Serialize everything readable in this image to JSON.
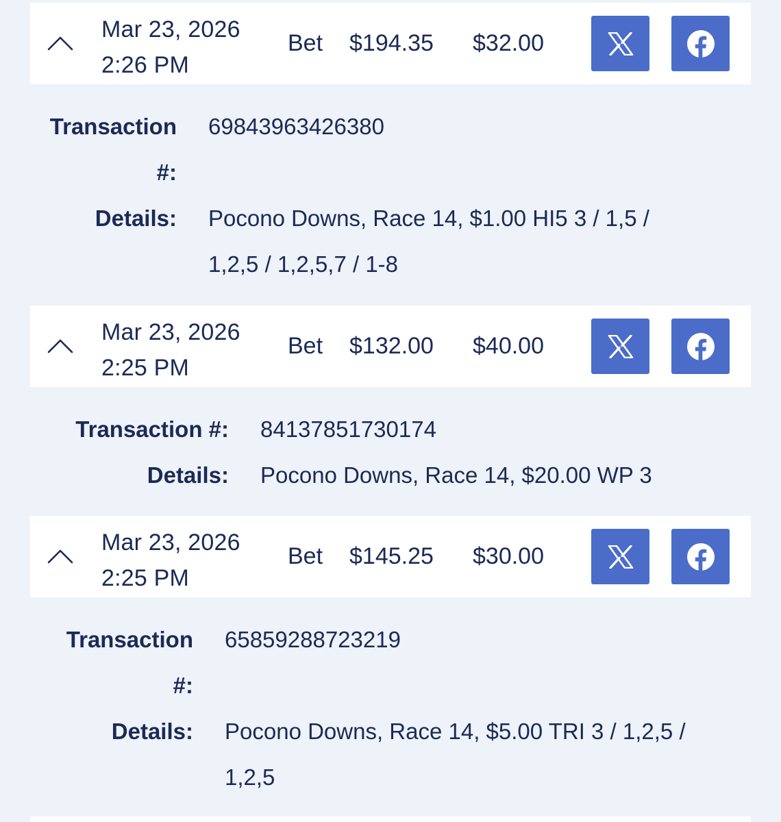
{
  "transactions": [
    {
      "date": "Mar 23, 2026",
      "time": "2:26 PM",
      "type": "Bet",
      "amount": "$194.35",
      "stake": "$32.00",
      "transaction_label_line1": "Transaction",
      "transaction_label_line2": "#:",
      "transaction_number": "69843963426380",
      "details_label": "Details:",
      "details_line1": "Pocono Downs, Race 14, $1.00 HI5 3 / 1,5 /",
      "details_line2": "1,2,5 / 1,2,5,7 / 1-8"
    },
    {
      "date": "Mar 23, 2026",
      "time": "2:25 PM",
      "type": "Bet",
      "amount": "$132.00",
      "stake": "$40.00",
      "transaction_label": "Transaction #:",
      "transaction_number": "84137851730174",
      "details_label": "Details:",
      "details_line1": "Pocono Downs, Race 14, $20.00 WP 3"
    },
    {
      "date": "Mar 23, 2026",
      "time": "2:25 PM",
      "type": "Bet",
      "amount": "$145.25",
      "stake": "$30.00",
      "transaction_label_line1": "Transaction",
      "transaction_label_line2": "#:",
      "transaction_number": "65859288723219",
      "details_label": "Details:",
      "details_line1": "Pocono Downs, Race 14, $5.00 TRI 3 / 1,2,5 /",
      "details_line2": "1,2,5"
    }
  ],
  "icons": {
    "collapse": "chevron-up-icon",
    "share_x": "x-logo-icon",
    "share_facebook": "facebook-icon"
  },
  "colors": {
    "page_background": "#eef2f9",
    "header_background": "#ffffff",
    "text": "#1b2a55",
    "share_button": "#4b6cc8"
  }
}
